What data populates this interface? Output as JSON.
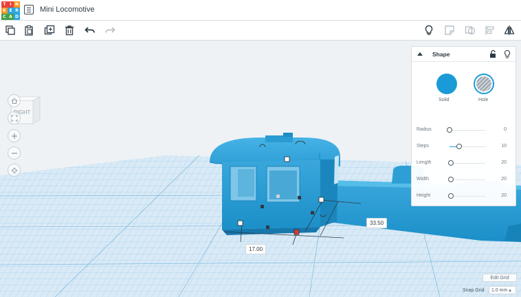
{
  "app": {
    "logo_letters": [
      "T",
      "I",
      "N",
      "K",
      "E",
      "R",
      "C",
      "A",
      "D"
    ],
    "logo_colors": [
      "#e8403a",
      "#e8403a",
      "#f7941d",
      "#f7941d",
      "#2aa6df",
      "#2aa6df",
      "#43a047",
      "#43a047",
      "#2aa6df"
    ],
    "project_title": "Mini Locomotive"
  },
  "toolbar": {
    "left": [
      "copy-icon",
      "paste-icon",
      "duplicate-icon",
      "delete-icon",
      "undo-icon",
      "redo-icon"
    ],
    "right": [
      "lightbulb-icon",
      "note-icon",
      "group-icon",
      "align-icon",
      "mirror-icon"
    ]
  },
  "viewcube": {
    "face_label": "RIGHT"
  },
  "nav": [
    "home-icon",
    "fit-icon",
    "zoom-in-icon",
    "zoom-out-icon",
    "perspective-icon"
  ],
  "dimensions": {
    "width_value": "17.00",
    "length_value": "33.50"
  },
  "inspector": {
    "title": "Shape",
    "solid_label": "Solid",
    "hole_label": "Hole",
    "accent": "#1a9bd7",
    "props": [
      {
        "label": "Radius",
        "value": "0",
        "level": 0.0
      },
      {
        "label": "Steps",
        "value": "10",
        "level": 0.27
      },
      {
        "label": "Length",
        "value": "20",
        "level": 0.04
      },
      {
        "label": "Width",
        "value": "20",
        "level": 0.04
      },
      {
        "label": "Height",
        "value": "20",
        "level": 0.04
      }
    ]
  },
  "grid_controls": {
    "edit_grid_label": "Edit Grid",
    "snap_grid_label": "Snap Grid",
    "snap_value": "1.0 mm ▴"
  }
}
